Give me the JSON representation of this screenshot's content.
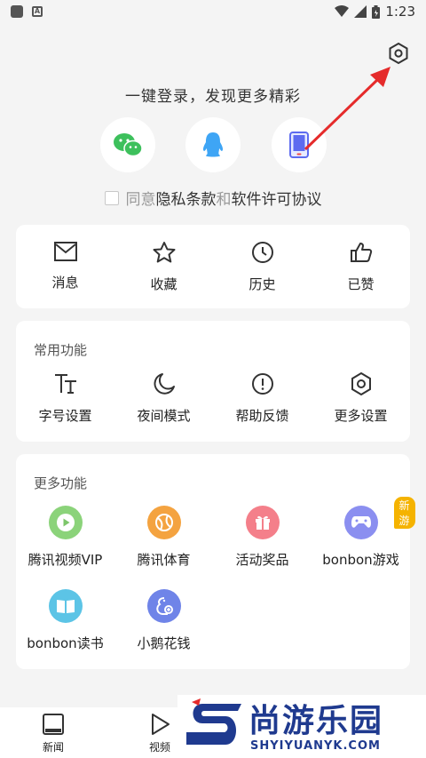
{
  "status_bar": {
    "time": "1:23"
  },
  "login": {
    "title": "一键登录，发现更多精彩",
    "agree_prefix": "同意",
    "privacy": "隐私条款",
    "and": "和",
    "license": "软件许可协议"
  },
  "quick": {
    "items": [
      {
        "label": "消息",
        "icon": "mail-icon"
      },
      {
        "label": "收藏",
        "icon": "star-icon"
      },
      {
        "label": "历史",
        "icon": "clock-icon"
      },
      {
        "label": "已赞",
        "icon": "thumbs-up-icon"
      }
    ]
  },
  "common": {
    "title": "常用功能",
    "items": [
      {
        "label": "字号设置",
        "icon": "font-size-icon"
      },
      {
        "label": "夜间模式",
        "icon": "moon-icon"
      },
      {
        "label": "帮助反馈",
        "icon": "help-icon"
      },
      {
        "label": "更多设置",
        "icon": "settings-icon"
      }
    ]
  },
  "more": {
    "title": "更多功能",
    "items": [
      {
        "label": "腾讯视频VIP",
        "icon": "video-play-icon",
        "color": "#8bd37a"
      },
      {
        "label": "腾讯体育",
        "icon": "sports-ball-icon",
        "color": "#f4a340"
      },
      {
        "label": "活动奖品",
        "icon": "gift-icon",
        "color": "#f47f8a"
      },
      {
        "label": "bonbon游戏",
        "icon": "gamepad-icon",
        "color": "#8b8ff0",
        "badge": "新游"
      },
      {
        "label": "bonbon读书",
        "icon": "book-icon",
        "color": "#5cc4e6"
      },
      {
        "label": "小鹅花钱",
        "icon": "wallet-icon",
        "color": "#6f84e8"
      }
    ]
  },
  "tabs": [
    {
      "label": "新闻",
      "icon": "news-icon"
    },
    {
      "label": "视频",
      "icon": "video-icon"
    }
  ],
  "watermark": {
    "main": "尚游乐园",
    "sub": "SHYIYUANYK.COM"
  }
}
